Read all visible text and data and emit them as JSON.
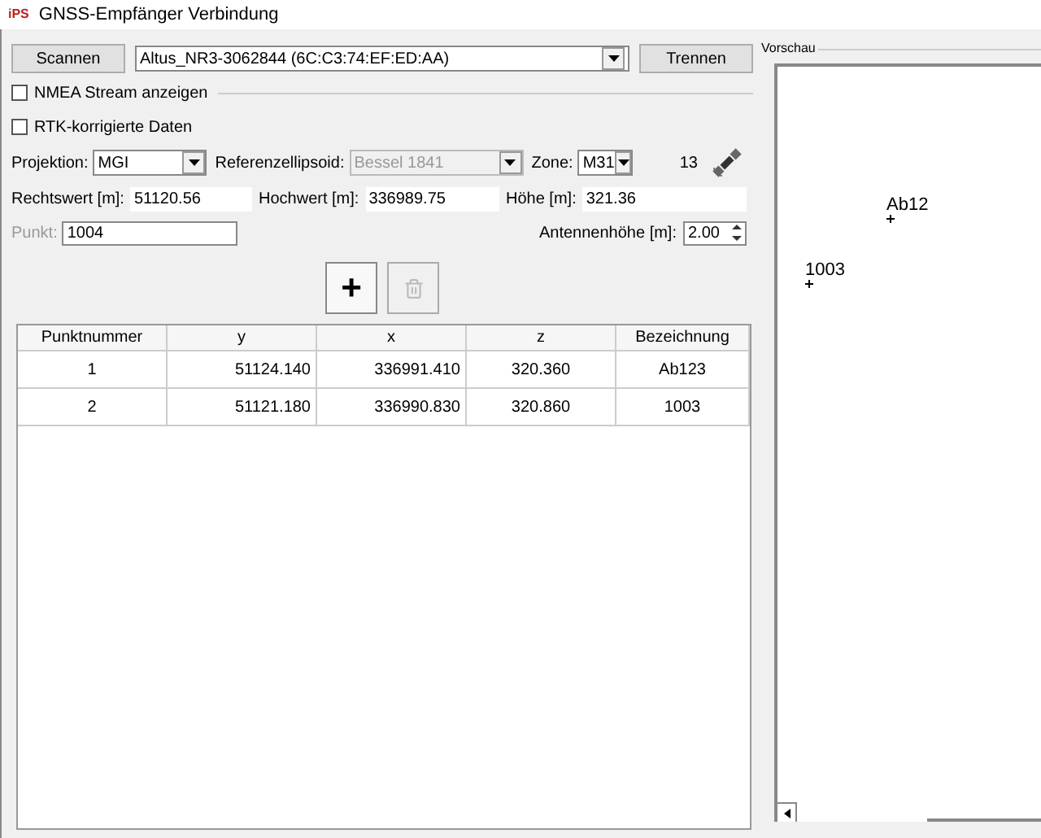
{
  "window": {
    "logo": "iPS",
    "title": "GNSS-Empfänger Verbindung"
  },
  "scan_button": "Scannen",
  "device": "Altus_NR3-3062844 (6C:C3:74:EF:ED:AA)",
  "disconnect_button": "Trennen",
  "options": [
    {
      "label": "NMEA Stream anzeigen",
      "checked": false
    },
    {
      "label": "RTK-korrigierte Daten",
      "checked": false
    }
  ],
  "projection": {
    "label": "Projektion:",
    "value": "MGI"
  },
  "ellipsoid": {
    "label": "Referenzellipsoid:",
    "value": "Bessel 1841",
    "disabled": true
  },
  "zone": {
    "label": "Zone:",
    "value": "M31"
  },
  "satellites": "13",
  "coords": [
    {
      "label": "Rechtswert [m]:",
      "value": "51120.56"
    },
    {
      "label": "Hochwert [m]:",
      "value": "336989.75"
    },
    {
      "label": "Höhe [m]:",
      "value": "321.36"
    }
  ],
  "point": {
    "label": "Punkt:",
    "value": "1004",
    "disabled": true
  },
  "antenna": {
    "label": "Antennenhöhe [m]:",
    "value": "2.00"
  },
  "add_button": {
    "label": "+",
    "disabled": false
  },
  "delete_button": {
    "disabled": true
  },
  "table": {
    "columns": [
      "Punktnummer",
      "y",
      "x",
      "z",
      "Bezeichnung"
    ],
    "rows": [
      [
        "1",
        "51124.140",
        "336991.410",
        "320.360",
        "Ab123"
      ],
      [
        "2",
        "51121.180",
        "336990.830",
        "320.860",
        "1003"
      ]
    ]
  },
  "preview": {
    "title": "Vorschau",
    "points": [
      {
        "label": "Ab12"
      },
      {
        "label": "1003"
      }
    ]
  }
}
